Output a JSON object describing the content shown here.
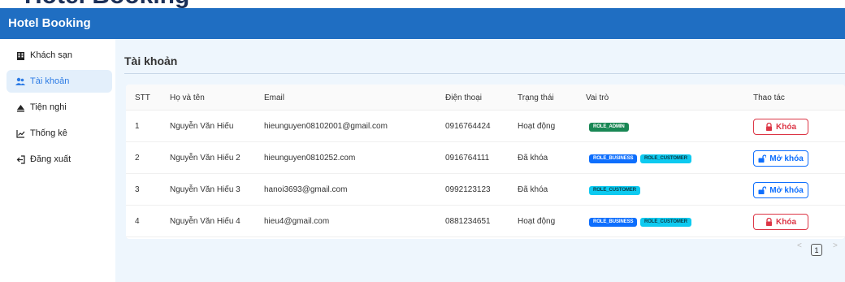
{
  "app": {
    "title": "Hotel Booking"
  },
  "sidebar": {
    "items": [
      {
        "label": "Khách sạn",
        "icon": "hotel-icon",
        "active": false
      },
      {
        "label": "Tài khoản",
        "icon": "users-icon",
        "active": true
      },
      {
        "label": "Tiện nghi",
        "icon": "amenities-icon",
        "active": false
      },
      {
        "label": "Thống kê",
        "icon": "chart-icon",
        "active": false
      },
      {
        "label": "Đăng xuất",
        "icon": "logout-icon",
        "active": false
      }
    ]
  },
  "page": {
    "title": "Tài khoản"
  },
  "table": {
    "columns": [
      "STT",
      "Họ và tên",
      "Email",
      "Điện thoại",
      "Trạng thái",
      "Vai trò",
      "Thao tác"
    ],
    "rows": [
      {
        "stt": "1",
        "name": "Nguyễn Văn Hiếu",
        "email": "hieunguyen08102001@gmail.com",
        "phone": "0916764424",
        "status": "Hoạt động",
        "roles": [
          "ROLE_ADMIN"
        ],
        "action": "Khóa"
      },
      {
        "stt": "2",
        "name": "Nguyễn Văn Hiếu 2",
        "email": "hieunguyen0810252.com",
        "phone": "0916764111",
        "status": "Đã khóa",
        "roles": [
          "ROLE_BUSINESS",
          "ROLE_CUSTOMER"
        ],
        "action": "Mở khóa"
      },
      {
        "stt": "3",
        "name": "Nguyễn Văn Hiếu 3",
        "email": "hanoi3693@gmail.com",
        "phone": "0992123123",
        "status": "Đã khóa",
        "roles": [
          "ROLE_CUSTOMER"
        ],
        "action": "Mở khóa"
      },
      {
        "stt": "4",
        "name": "Nguyễn Văn Hiếu 4",
        "email": "hieu4@gmail.com",
        "phone": "0881234651",
        "status": "Hoạt động",
        "roles": [
          "ROLE_BUSINESS",
          "ROLE_CUSTOMER"
        ],
        "action": "Khóa"
      }
    ]
  },
  "pagination": {
    "current_page": "1",
    "prev": "<",
    "next": ">"
  },
  "colors": {
    "header": "#1f6ec2",
    "accent": "#2c7be5",
    "admin_badge": "#198754",
    "business_badge": "#0d6efd",
    "customer_badge": "#0dcaf0",
    "danger": "#dc3545"
  }
}
